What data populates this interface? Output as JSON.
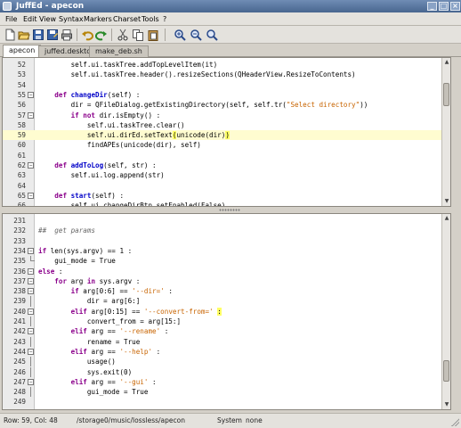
{
  "window": {
    "title": "JuffEd - apecon"
  },
  "menu": {
    "file": "File",
    "edit": "Edit",
    "view": "View",
    "syntax": "Syntax",
    "markers": "Markers",
    "charset": "Charset",
    "tools": "Tools",
    "help": "?"
  },
  "toolbar_icons": [
    "new-file-icon",
    "open-file-icon",
    "save-icon",
    "save-as-icon",
    "print-icon",
    "undo-icon",
    "redo-icon",
    "cut-icon",
    "copy-icon",
    "paste-icon",
    "zoom-in-icon",
    "zoom-out-icon",
    "zoom-reset-icon"
  ],
  "tabs": [
    {
      "label": "apecon",
      "active": true
    },
    {
      "label": "juffed.desktop",
      "active": false
    },
    {
      "label": "make_deb.sh",
      "active": false
    }
  ],
  "top_pane": {
    "lines": [
      {
        "n": "52",
        "fold": "",
        "html": "        self.ui.taskTree.addTopLevelItem(it)"
      },
      {
        "n": "53",
        "fold": "",
        "html": "        self.ui.taskTree.header().resizeSections(QHeaderView.ResizeToContents)"
      },
      {
        "n": "54",
        "fold": "",
        "html": ""
      },
      {
        "n": "55",
        "fold": "−",
        "html": "    <span class=\"kw\">def</span> <span class=\"fn\">changeDir</span>(self) :"
      },
      {
        "n": "56",
        "fold": "",
        "html": "        dir = QFileDialog.getExistingDirectory(self, self.tr(<span class=\"st\">\"Select directory\"</span>))"
      },
      {
        "n": "57",
        "fold": "−",
        "html": "        <span class=\"kw\">if not</span> dir.isEmpty() :"
      },
      {
        "n": "58",
        "fold": "",
        "html": "            self.ui.taskTree.clear()"
      },
      {
        "n": "59",
        "fold": "",
        "html": "            self.ui.dirEd.setText<span class=\"br\">(</span>unicode(dir)<span class=\"br\">)</span>",
        "highlight": true
      },
      {
        "n": "60",
        "fold": "",
        "html": "            findAPEs(unicode(dir), self)"
      },
      {
        "n": "61",
        "fold": "",
        "html": ""
      },
      {
        "n": "62",
        "fold": "−",
        "html": "    <span class=\"kw\">def</span> <span class=\"fn\">addToLog</span>(self, str) :"
      },
      {
        "n": "63",
        "fold": "",
        "html": "        self.ui.log.append(str)"
      },
      {
        "n": "64",
        "fold": "",
        "html": ""
      },
      {
        "n": "65",
        "fold": "−",
        "html": "    <span class=\"kw\">def</span> <span class=\"fn\">start</span>(self) :"
      },
      {
        "n": "66",
        "fold": "",
        "html": "        self.ui.changeDirBtn.setEnabled(False)"
      }
    ]
  },
  "bottom_pane": {
    "lines": [
      {
        "n": "231",
        "fold": "",
        "html": ""
      },
      {
        "n": "232",
        "fold": "",
        "html": "<span class=\"cm\">##  get params</span>"
      },
      {
        "n": "233",
        "fold": "",
        "html": ""
      },
      {
        "n": "234",
        "fold": "−",
        "html": "<span class=\"kw\">if</span> len(sys.argv) == 1 :"
      },
      {
        "n": "235",
        "fold": "end",
        "html": "    gui_mode = True"
      },
      {
        "n": "236",
        "fold": "−",
        "html": "<span class=\"kw\">else</span> :"
      },
      {
        "n": "237",
        "fold": "−",
        "html": "    <span class=\"kw\">for</span> arg <span class=\"kw\">in</span> sys.argv :"
      },
      {
        "n": "238",
        "fold": "−",
        "html": "        <span class=\"kw\">if</span> arg[0:6] == <span class=\"st\">'--dir='</span> :"
      },
      {
        "n": "239",
        "fold": "bar",
        "html": "            dir = arg[6:]"
      },
      {
        "n": "240",
        "fold": "−",
        "html": "        <span class=\"kw\">elif</span> arg[0:15] == <span class=\"st\">'--convert-from='</span> <span class=\"br\">:</span>"
      },
      {
        "n": "241",
        "fold": "bar",
        "html": "            convert_from = arg[15:]"
      },
      {
        "n": "242",
        "fold": "−",
        "html": "        <span class=\"kw\">elif</span> arg == <span class=\"st\">'--rename'</span> :"
      },
      {
        "n": "243",
        "fold": "bar",
        "html": "            rename = True"
      },
      {
        "n": "244",
        "fold": "−",
        "html": "        <span class=\"kw\">elif</span> arg == <span class=\"st\">'--help'</span> :"
      },
      {
        "n": "245",
        "fold": "bar",
        "html": "            usage()"
      },
      {
        "n": "246",
        "fold": "bar",
        "html": "            sys.exit(0)"
      },
      {
        "n": "247",
        "fold": "−",
        "html": "        <span class=\"kw\">elif</span> arg == <span class=\"st\">'--gui'</span> :"
      },
      {
        "n": "248",
        "fold": "bar",
        "html": "            gui_mode = True"
      },
      {
        "n": "249",
        "fold": "",
        "html": ""
      },
      {
        "n": "250",
        "fold": "",
        "html": ""
      }
    ]
  },
  "status": {
    "position": "Row: 59, Col: 48",
    "file": "/storage0/music/lossless/apecon",
    "charset": "System",
    "mode": "none"
  }
}
